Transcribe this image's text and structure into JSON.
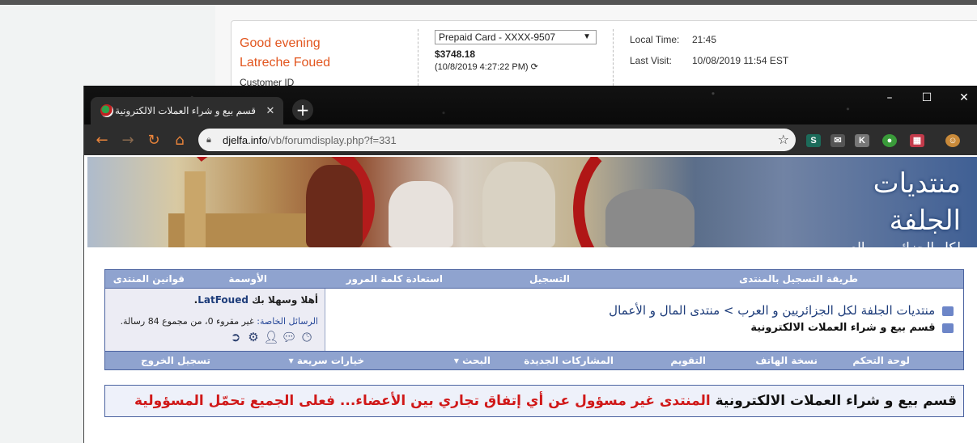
{
  "background_page": {
    "greeting_line1": "Good evening",
    "greeting_line2": "Latreche Foued",
    "customer_id_label": "Customer ID",
    "card_select": "Prepaid Card - XXXX-9507",
    "balance": "$3748.18",
    "balance_time": "(10/8/2019 4:27:22 PM)",
    "local_time_label": "Local Time:",
    "local_time_value": "21:45",
    "last_visit_label": "Last Visit:",
    "last_visit_value": "10/08/2019 11:54 EST"
  },
  "browser": {
    "tab_title": "قسم بيع و شراء العملات الالكترونية",
    "url_host": "djelfa.info",
    "url_path": "/vb/forumdisplay.php?f=331",
    "window_controls": {
      "minimize": "–",
      "maximize": "☐",
      "close": "✕"
    },
    "extension_icons": [
      "S",
      "✉",
      "K",
      "●",
      "▦",
      "☺"
    ]
  },
  "forum": {
    "logo_line1": "منتديات الجلفة",
    "logo_line2": "لكل الجزائريين والعرب",
    "top_nav": [
      "طريقة التسجيل بالمنتدى",
      "التسجيل",
      "استعادة كلمة المرور",
      "الأوسمة",
      "قوانين المنتدى"
    ],
    "breadcrumb_root": "منتديات الجلفة لكل الجزائريين و العرب",
    "breadcrumb_sep": ">",
    "breadcrumb_section": "منتدى المال و الأعمال",
    "current_forum": "قسم بيع و شراء العملات الالكترونية",
    "welcome_prefix": "أهلا وسهلا بك",
    "username": "LatFoued",
    "welcome_suffix": ".",
    "pm_label": "الرسائل الخاصة:",
    "pm_text": "غير مقروء 0، من مجموع 84 رسالة.",
    "bottom_nav": [
      "لوحة التحكم",
      "نسخة الهاتف",
      "التقويم",
      "المشاركات الجديدة",
      "البحث",
      "خيارات سريعة",
      "تسجيل الخروج"
    ],
    "notice_black": "قسم بيع و شراء العملات الالكترونية",
    "notice_red": "المنتدى غير مسؤول عن أي إتفاق تجاري بين الأعضاء... فعلى الجميع تحمّل المسؤولية"
  }
}
